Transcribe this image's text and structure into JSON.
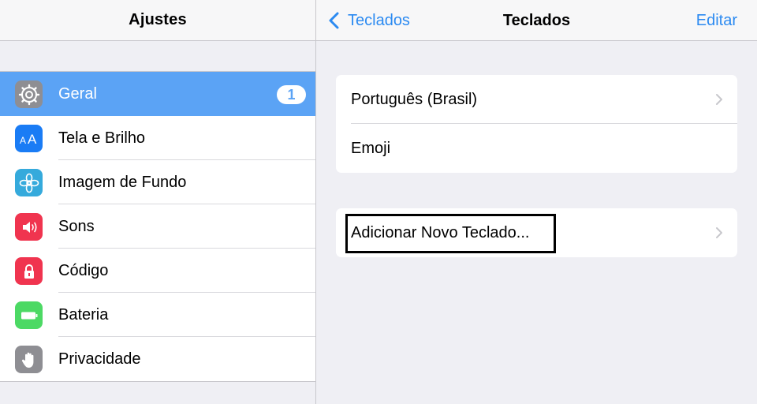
{
  "left_pane": {
    "title": "Ajustes",
    "items": [
      {
        "label": "Geral",
        "icon": "gear-icon",
        "icon_color": "#8e8e93",
        "badge": "1",
        "selected": true
      },
      {
        "label": "Tela e Brilho",
        "icon": "text-size-icon",
        "icon_color": "#1a7cf5"
      },
      {
        "label": "Imagem de Fundo",
        "icon": "flower-icon",
        "icon_color": "#35aadc"
      },
      {
        "label": "Sons",
        "icon": "speaker-icon",
        "icon_color": "#f0344f"
      },
      {
        "label": "Código",
        "icon": "lock-icon",
        "icon_color": "#f0344f"
      },
      {
        "label": "Bateria",
        "icon": "battery-icon",
        "icon_color": "#4cd964"
      },
      {
        "label": "Privacidade",
        "icon": "hand-icon",
        "icon_color": "#8e8e93"
      }
    ]
  },
  "right_pane": {
    "back_label": "Teclados",
    "title": "Teclados",
    "edit_label": "Editar",
    "keyboards": [
      "Português (Brasil)",
      "Emoji"
    ],
    "add_keyboard_label": "Adicionar Novo Teclado..."
  },
  "colors": {
    "accent": "#2b8af1",
    "selection": "#5ba3f5",
    "background": "#efeff4"
  }
}
